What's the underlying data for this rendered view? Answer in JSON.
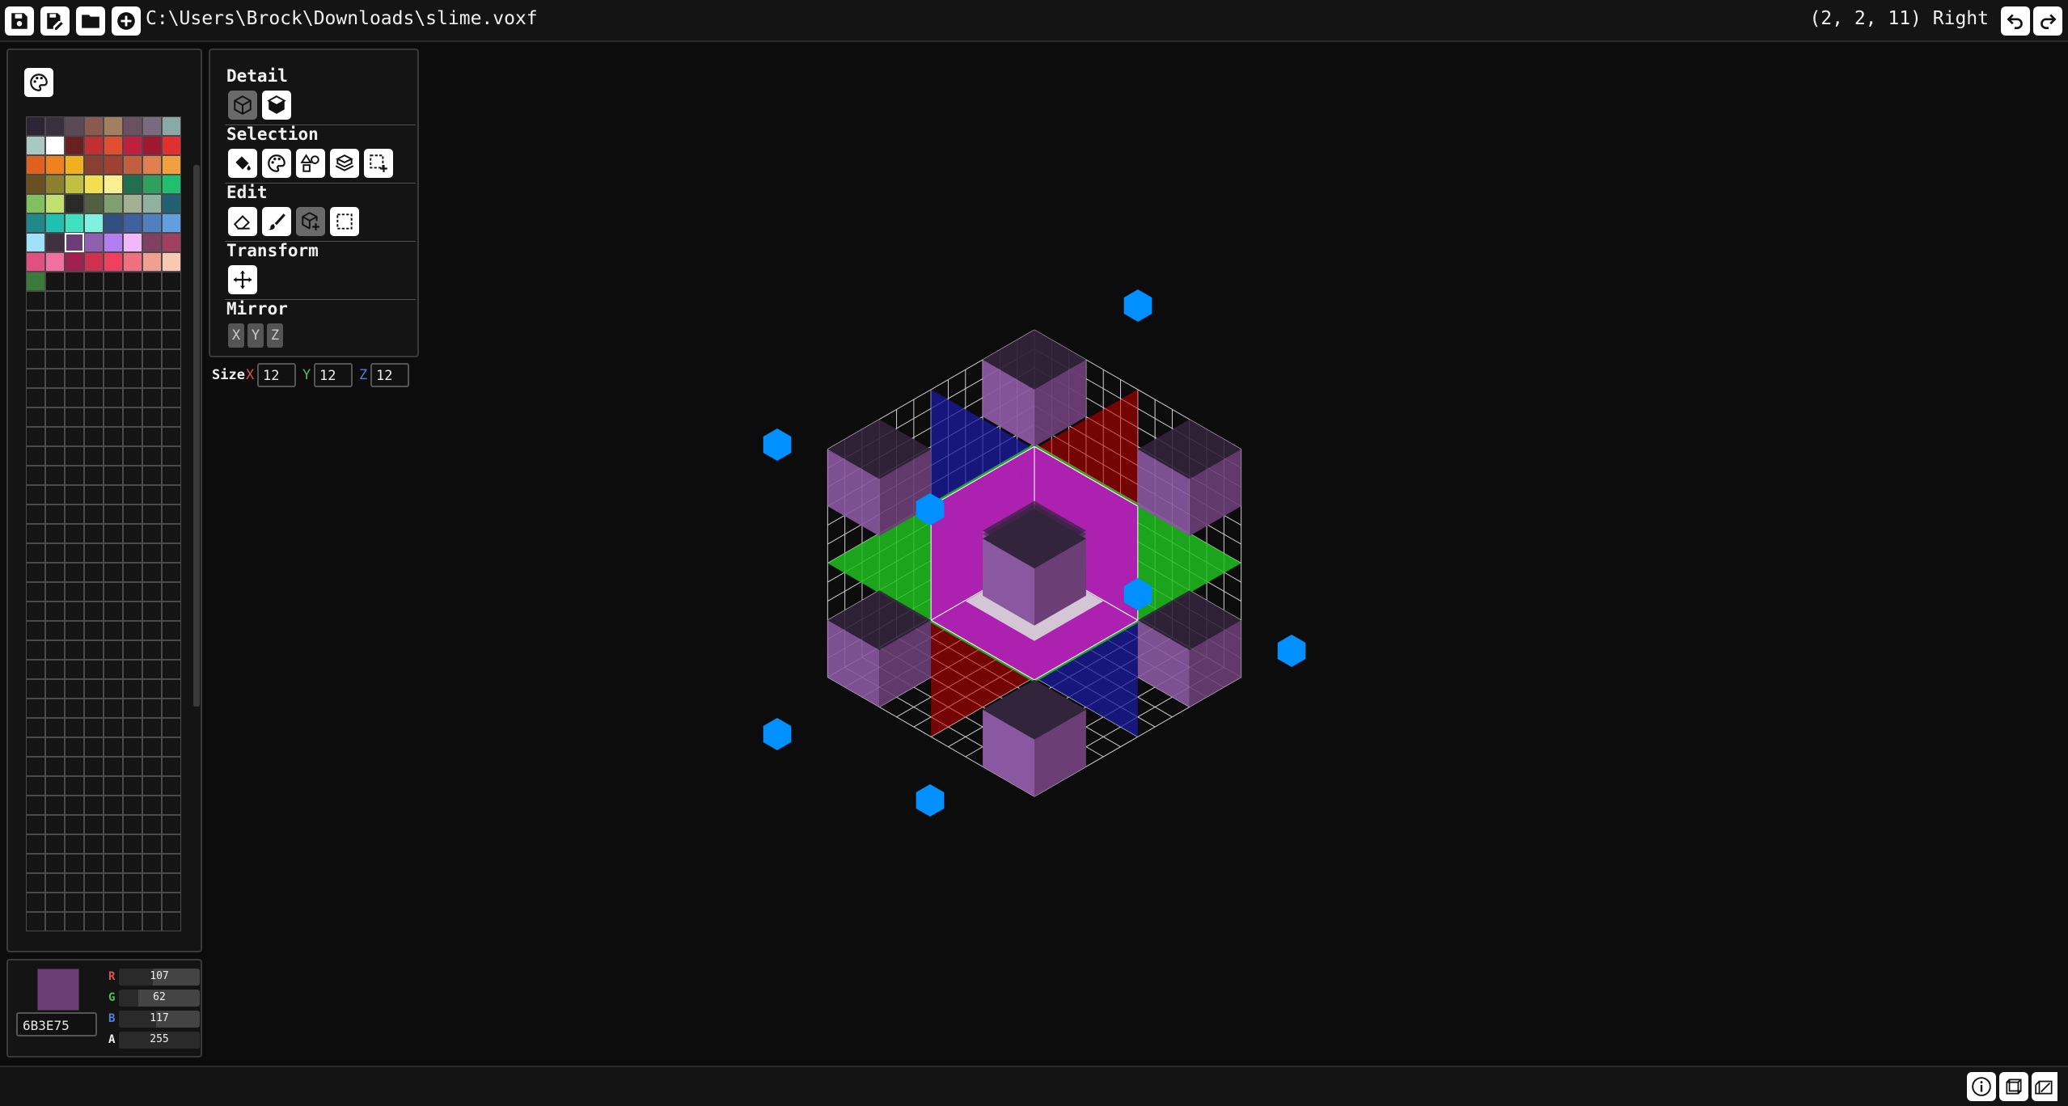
{
  "topbar": {
    "file_path": "C:\\Users\\Brock\\Downloads\\slime.voxf",
    "coords": "(2, 2, 11) Right"
  },
  "palette": {
    "colors": [
      "#2d2535",
      "#3a3040",
      "#5a4a55",
      "#8a5a50",
      "#a08060",
      "#6a5060",
      "#7a6a80",
      "#8aa8a8",
      "#a8c8c0",
      "#ffffff",
      "#6a2020",
      "#c03030",
      "#e05030",
      "#c02040",
      "#a01830",
      "#e03030",
      "#e06020",
      "#f08020",
      "#f0b020",
      "#8a4030",
      "#a04030",
      "#c06040",
      "#e08050",
      "#f0a040",
      "#6a5020",
      "#8a8030",
      "#c0c040",
      "#f0e050",
      "#f8f090",
      "#207050",
      "#30a060",
      "#20c070",
      "#80c060",
      "#c0e070",
      "#2a2a2a",
      "#506040",
      "#80a070",
      "#a0b090",
      "#90b0a0",
      "#206070",
      "#208888",
      "#20c0b0",
      "#40e0c0",
      "#80f0e0",
      "#305080",
      "#4060a0",
      "#5080c0",
      "#60a0e0",
      "#a0e0f8",
      "#403040",
      "#6B3E75",
      "#9060b0",
      "#b080f0",
      "#f0b8f8",
      "#804060",
      "#a04060",
      "#e05080",
      "#f070a0",
      "#a02050",
      "#d03050",
      "#f04060",
      "#f07080",
      "#f0a090",
      "#f8c8b0",
      "#3a7a3a"
    ],
    "selected_index": 50
  },
  "tools": {
    "detail_label": "Detail",
    "selection_label": "Selection",
    "edit_label": "Edit",
    "transform_label": "Transform",
    "mirror_label": "Mirror",
    "mirror_x": "X",
    "mirror_y": "Y",
    "mirror_z": "Z"
  },
  "size": {
    "label": "Size",
    "x_label": "X",
    "y_label": "Y",
    "z_label": "Z",
    "x": "12",
    "y": "12",
    "z": "12"
  },
  "color": {
    "hex": "6B3E75",
    "swatch": "#6B3E75",
    "r_label": "R",
    "g_label": "G",
    "b_label": "B",
    "a_label": "A",
    "r": "107",
    "g": "62",
    "b": "117",
    "a": "255",
    "r_value": 107,
    "g_value": 62,
    "b_value": 117,
    "a_value": 255
  },
  "viewport": {
    "grid_size": 12,
    "voxel_color": "#6B3E75",
    "accent_blue": "#0090ff"
  }
}
